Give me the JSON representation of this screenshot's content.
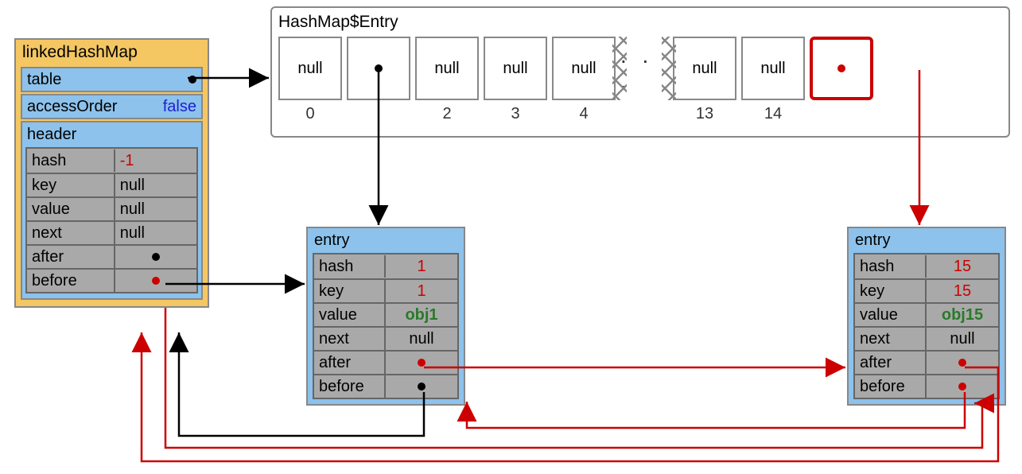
{
  "linkedHashMap": {
    "title": "linkedHashMap",
    "table_label": "table",
    "accessOrder_label": "accessOrder",
    "accessOrder_value": "false",
    "header": {
      "title": "header",
      "rows": {
        "hash": {
          "k": "hash",
          "v": "-1"
        },
        "key": {
          "k": "key",
          "v": "null"
        },
        "value": {
          "k": "value",
          "v": "null"
        },
        "next": {
          "k": "next",
          "v": "null"
        },
        "after": {
          "k": "after"
        },
        "before": {
          "k": "before"
        }
      }
    }
  },
  "array": {
    "title": "HashMap$Entry",
    "cells": [
      {
        "text": "null",
        "idx": "0"
      },
      {
        "dot": true,
        "idx": ""
      },
      {
        "text": "null",
        "idx": "2"
      },
      {
        "text": "null",
        "idx": "3"
      },
      {
        "text": "null",
        "idx": "4"
      }
    ],
    "ellipsis": ". . .",
    "cells2": [
      {
        "text": "null",
        "idx": "13"
      },
      {
        "text": "null",
        "idx": "14"
      },
      {
        "highlight": true,
        "dot_red": true,
        "idx": ""
      }
    ]
  },
  "entry1": {
    "title": "entry",
    "rows": {
      "hash": {
        "k": "hash",
        "v": "1",
        "cls": "val-red"
      },
      "key": {
        "k": "key",
        "v": "1",
        "cls": "val-red"
      },
      "value": {
        "k": "value",
        "v": "obj1",
        "cls": "val-green"
      },
      "next": {
        "k": "next",
        "v": "null"
      },
      "after": {
        "k": "after"
      },
      "before": {
        "k": "before"
      }
    }
  },
  "entry15": {
    "title": "entry",
    "rows": {
      "hash": {
        "k": "hash",
        "v": "15",
        "cls": "val-red"
      },
      "key": {
        "k": "key",
        "v": "15",
        "cls": "val-red"
      },
      "value": {
        "k": "value",
        "v": "obj15",
        "cls": "val-green"
      },
      "next": {
        "k": "next",
        "v": "null"
      },
      "after": {
        "k": "after"
      },
      "before": {
        "k": "before"
      }
    }
  }
}
